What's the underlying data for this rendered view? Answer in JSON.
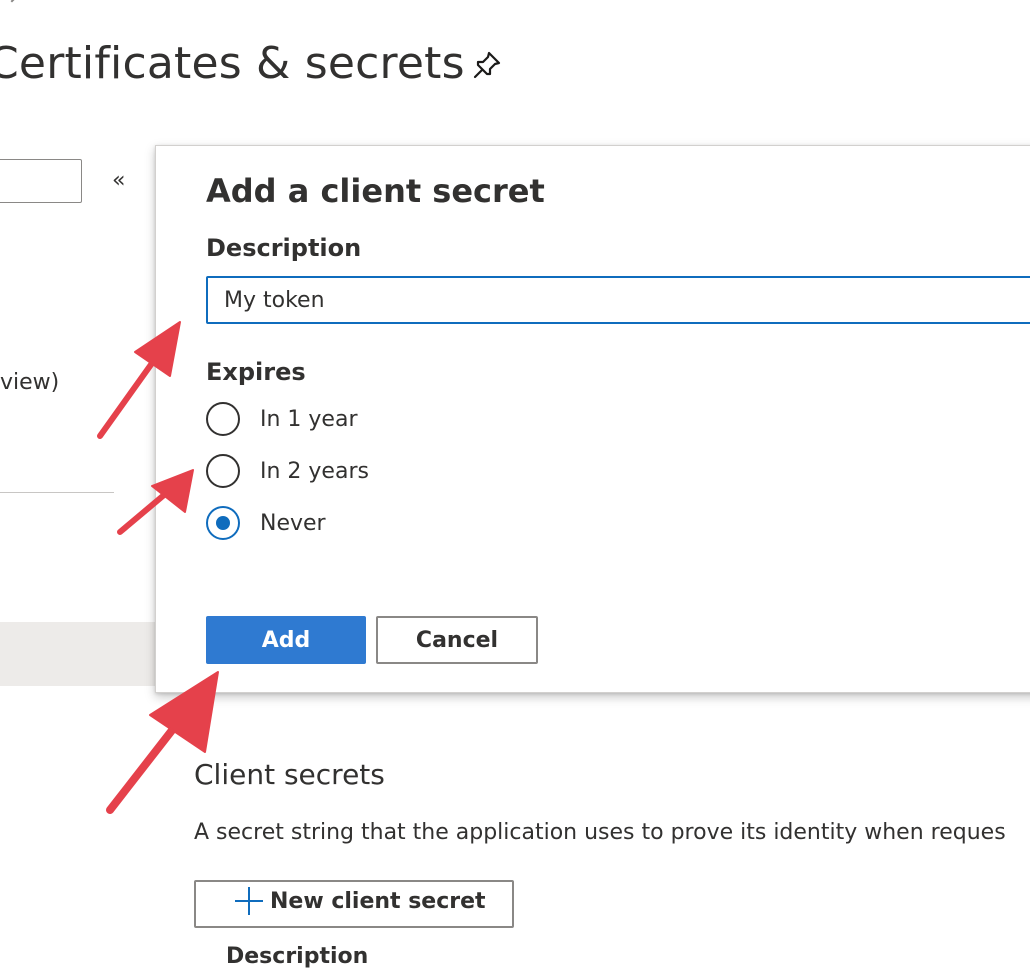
{
  "page": {
    "title": "Certificates & secrets",
    "pin_icon": "pin-icon",
    "collapse_icon_glyph": "«",
    "left_fragment_text": "view)"
  },
  "panel": {
    "title": "Add a client secret",
    "description_label": "Description",
    "description_value": "My token",
    "expires_label": "Expires",
    "expires_options": [
      {
        "label": "In 1 year",
        "selected": false
      },
      {
        "label": "In 2 years",
        "selected": false
      },
      {
        "label": "Never",
        "selected": true
      }
    ],
    "add_label": "Add",
    "cancel_label": "Cancel"
  },
  "client_secrets": {
    "title": "Client secrets",
    "description": "A secret string that the application uses to prove its identity when reques",
    "new_button_label": "New client secret",
    "new_button_icon": "plus-icon",
    "column_header": "Description"
  },
  "colors": {
    "accent": "#0f6cbd",
    "primary_button": "#2f7ad1",
    "annotation_arrow": "#e5414b",
    "text": "#323130"
  }
}
